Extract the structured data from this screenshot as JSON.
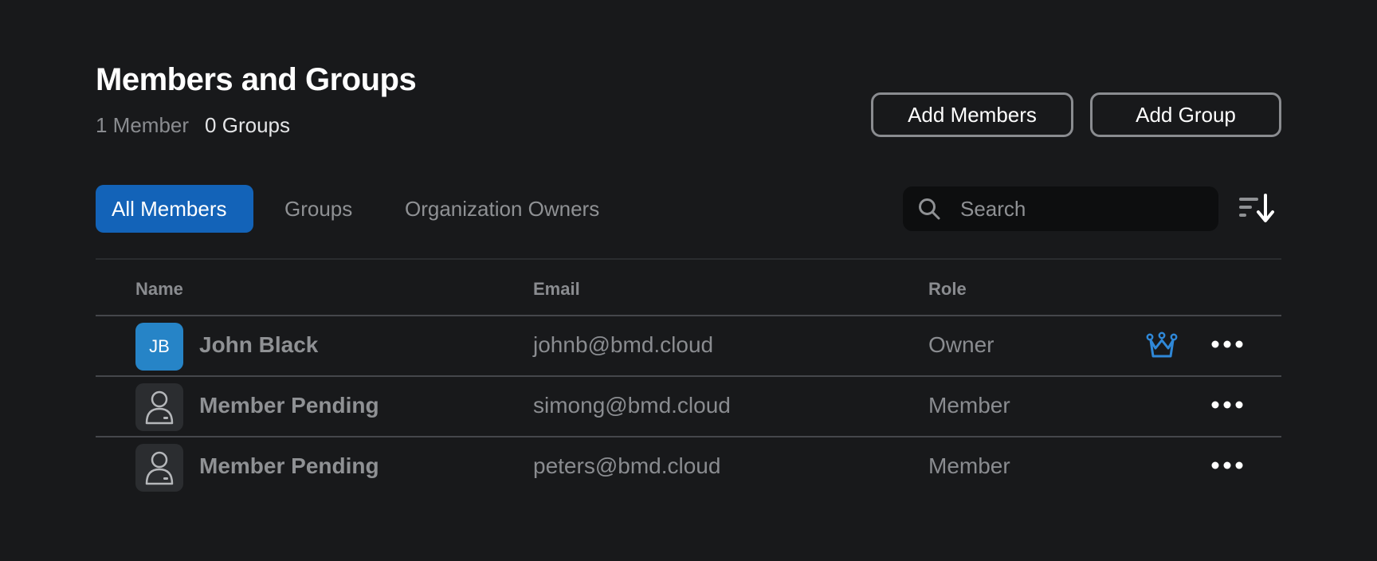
{
  "header": {
    "title": "Members and Groups",
    "member_count": "1 Member",
    "group_count": "0 Groups",
    "add_members_label": "Add Members",
    "add_group_label": "Add Group"
  },
  "tabs": [
    {
      "label": "All Members",
      "active": true
    },
    {
      "label": "Groups",
      "active": false
    },
    {
      "label": "Organization Owners",
      "active": false
    }
  ],
  "search": {
    "placeholder": "Search",
    "value": "",
    "icon": "search-icon"
  },
  "sort": {
    "icon": "sort-descending-icon"
  },
  "table": {
    "columns": [
      "Name",
      "Email",
      "Role"
    ],
    "rows": [
      {
        "initials": "JB",
        "name": "John Black",
        "email": "johnb@bmd.cloud",
        "role": "Owner",
        "avatar_icon": "",
        "role_icon": "crown-icon"
      },
      {
        "initials": "",
        "name": "Member Pending",
        "email": "simong@bmd.cloud",
        "role": "Member",
        "avatar_icon": "person-placeholder-icon",
        "role_icon": ""
      },
      {
        "initials": "",
        "name": "Member Pending",
        "email": "peters@bmd.cloud",
        "role": "Member",
        "avatar_icon": "person-placeholder-icon",
        "role_icon": ""
      }
    ]
  },
  "colors": {
    "background": "#18191b",
    "accent": "#1363b8",
    "avatar_blue": "#2684c7",
    "crown_blue": "#2f88d8"
  }
}
